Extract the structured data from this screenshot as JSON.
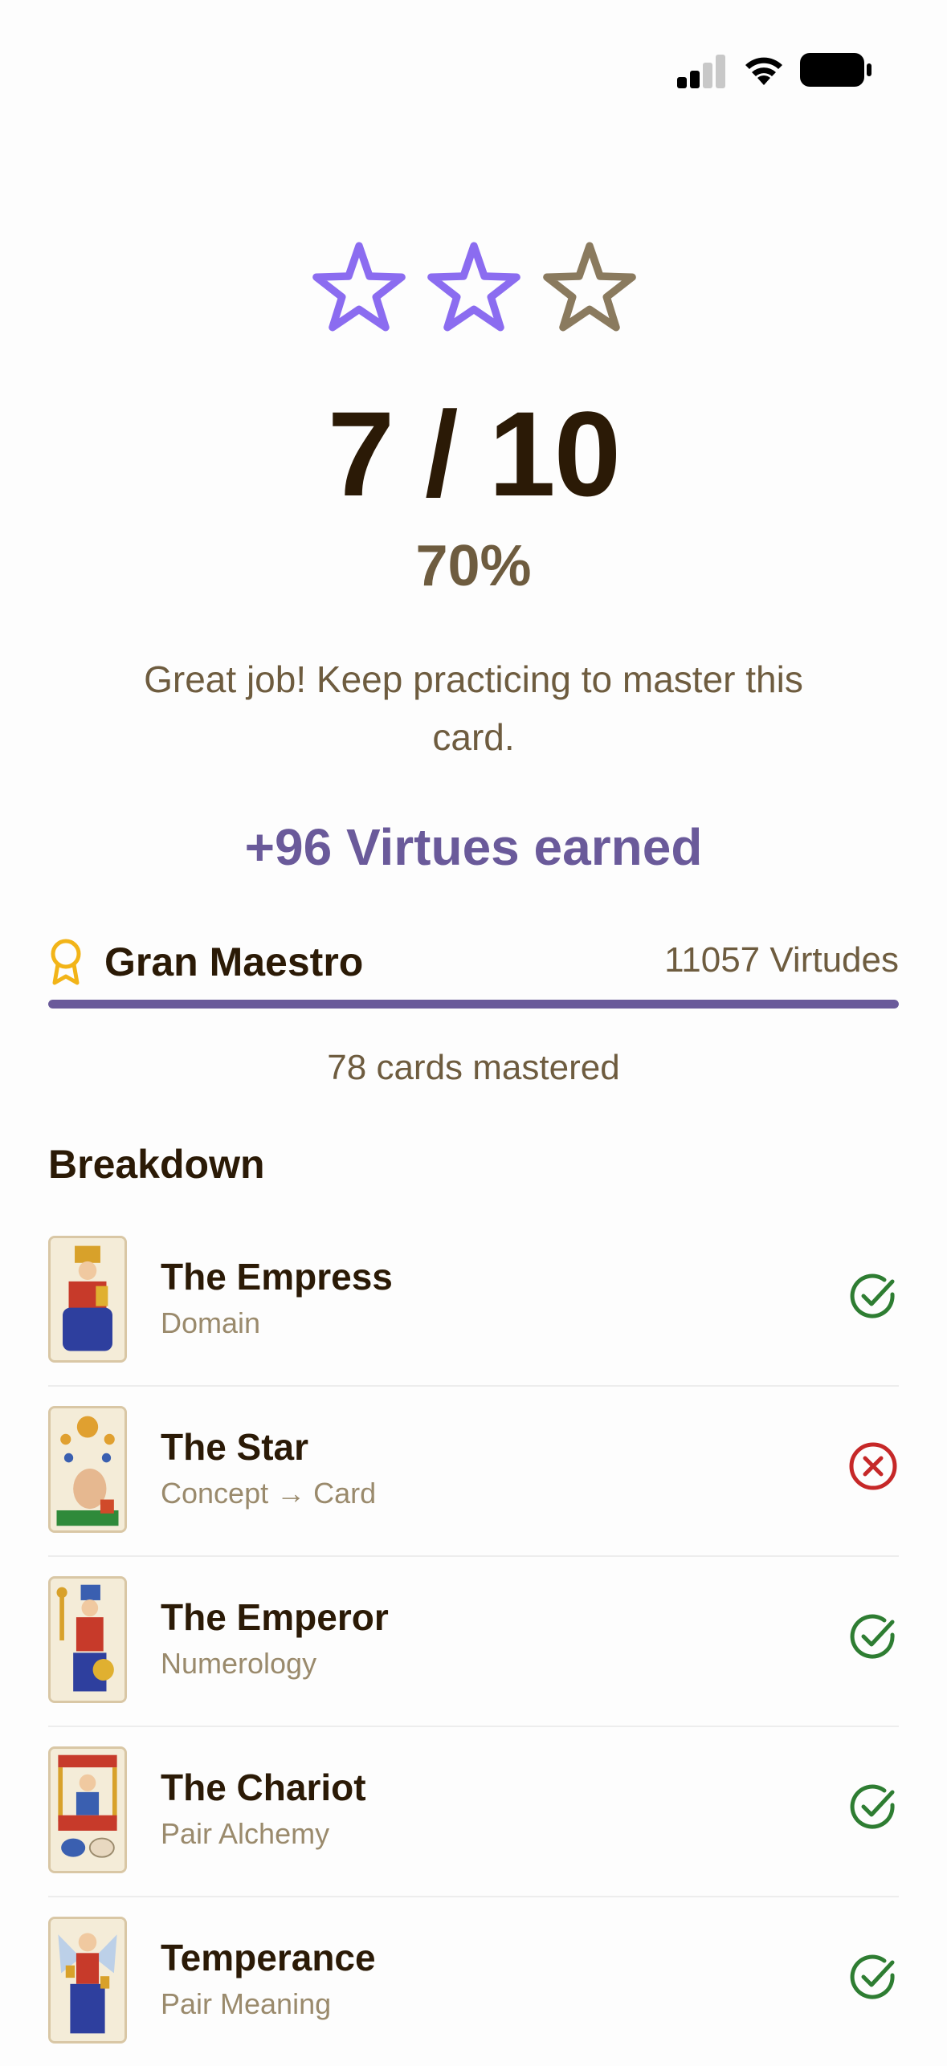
{
  "stars": {
    "filled": 2,
    "total": 3,
    "filled_color": "#8b6cf0",
    "empty_color": "#8a7a5e"
  },
  "score": {
    "text": "7 / 10",
    "percent": "70%"
  },
  "message": "Great job! Keep practicing to master this card.",
  "earned": "+96 Virtues earned",
  "rank": {
    "icon": "award-ribbon-icon",
    "name": "Gran Maestro",
    "virtues": "11057 Virtudes",
    "progress": 1.0
  },
  "mastered": "78 cards mastered",
  "breakdown": {
    "title": "Breakdown",
    "items": [
      {
        "name": "The Empress",
        "type": "Domain",
        "correct": true
      },
      {
        "name": "The Star",
        "type": "Concept → Card",
        "correct": false
      },
      {
        "name": "The Emperor",
        "type": "Numerology",
        "correct": true
      },
      {
        "name": "The Chariot",
        "type": "Pair Alchemy",
        "correct": true
      },
      {
        "name": "Temperance",
        "type": "Pair Meaning",
        "correct": true
      }
    ]
  },
  "colors": {
    "correct": "#2e7d32",
    "wrong": "#c62828",
    "accent": "#6a5a9a"
  }
}
